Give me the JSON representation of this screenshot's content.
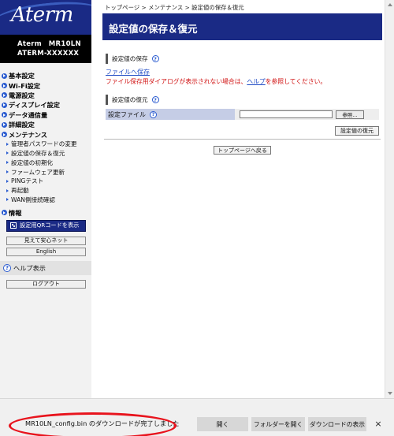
{
  "sidebar": {
    "logo": "Aterm",
    "model_line1": "Aterm　MR10LN",
    "model_line2": "ATERM-XXXXXX",
    "menu": [
      "基本設定",
      "Wi-Fi設定",
      "電源設定",
      "ディスプレイ設定",
      "データ通信量",
      "詳細設定",
      "メンテナンス"
    ],
    "maintenance_sub": [
      "管理者パスワードの変更",
      "設定値の保存＆復元",
      "設定値の初期化",
      "ファームウェア更新",
      "PINGテスト",
      "再起動",
      "WAN側接続確認"
    ],
    "info_label": "情報",
    "qr_button": "設定用QRコードを表示",
    "mieru_button": "見えて安心ネット",
    "english_button": "English",
    "help_label": "ヘルプ表示",
    "logout_button": "ログアウト"
  },
  "main": {
    "breadcrumb": "トップページ > メンテナンス > 設定値の保存＆復元",
    "title": "設定値の保存＆復元",
    "save_section": "設定値の保存",
    "file_save_link": "ファイルへ保存",
    "note_prefix": "ファイル保存用ダイアログが表示されない場合は、",
    "note_help_link": "ヘルプ",
    "note_suffix": "を参照してください。",
    "restore_section": "設定値の復元",
    "file_label": "設定ファイル",
    "browse_button": "参照...",
    "restore_button": "設定値の復元",
    "top_page_button": "トップページへ戻る",
    "help_icon_char": "?"
  },
  "download_bar": {
    "message": "MR10LN_config.bin のダウンロードが完了しました",
    "open_button": "開く",
    "open_folder_button": "フォルダーを開く",
    "view_downloads_button": "ダウンロードの表示",
    "close_char": "×"
  },
  "colors": {
    "brand_navy": "#1a2a85",
    "link_blue": "#1d49c4",
    "warning_red": "#d01010",
    "highlight_ellipse": "#e8141d"
  }
}
